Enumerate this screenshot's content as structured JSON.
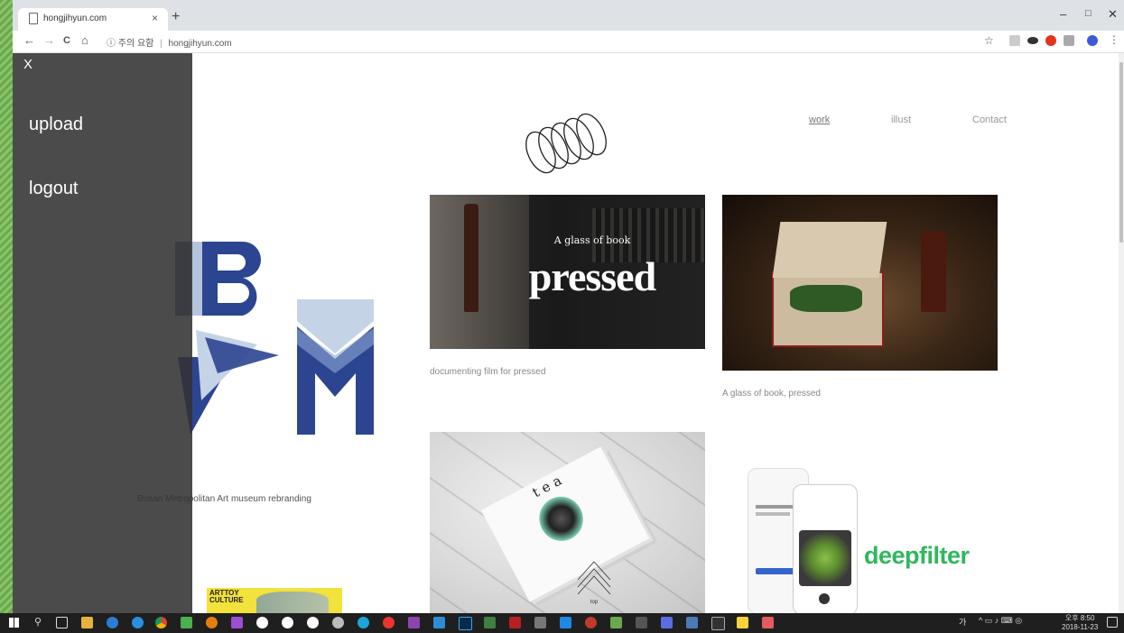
{
  "browser": {
    "tab_title": "hongjihyun.com",
    "tab_close": "×",
    "new_tab": "+",
    "minimize": "–",
    "maximize": "□",
    "close": "✕",
    "back": "←",
    "forward": "→",
    "reload": "C",
    "home": "⌂",
    "security_icon": "ⓘ",
    "security_text": "주의 요함",
    "url": "hongjihyun.com",
    "bookmark": "☆"
  },
  "nav": {
    "work": "work",
    "illust": "illust",
    "contact": "Contact"
  },
  "sidebar": {
    "close": "X",
    "upload": "upload",
    "logout": "logout"
  },
  "works": [
    {
      "caption": "Busan Metropolitan Art museum rebranding"
    },
    {
      "title_small": "A glass of book",
      "title_big": "pressed",
      "caption": "documenting film for pressed"
    },
    {
      "caption": "A glass of book, pressed"
    },
    {
      "title": "tea"
    },
    {
      "brand": "deepfilter"
    },
    {
      "title": "ARTTOY CULTURE"
    }
  ],
  "top_button": "top",
  "taskbar": {
    "ime": "가",
    "clock_time": "오후 8:50",
    "clock_date": "2018-11-23"
  },
  "colors": {
    "sidebar_bg": "#333333",
    "museum_blue": "#2c4591",
    "museum_light": "#c5d3e6",
    "deepfilter_green": "#2eb85c"
  }
}
